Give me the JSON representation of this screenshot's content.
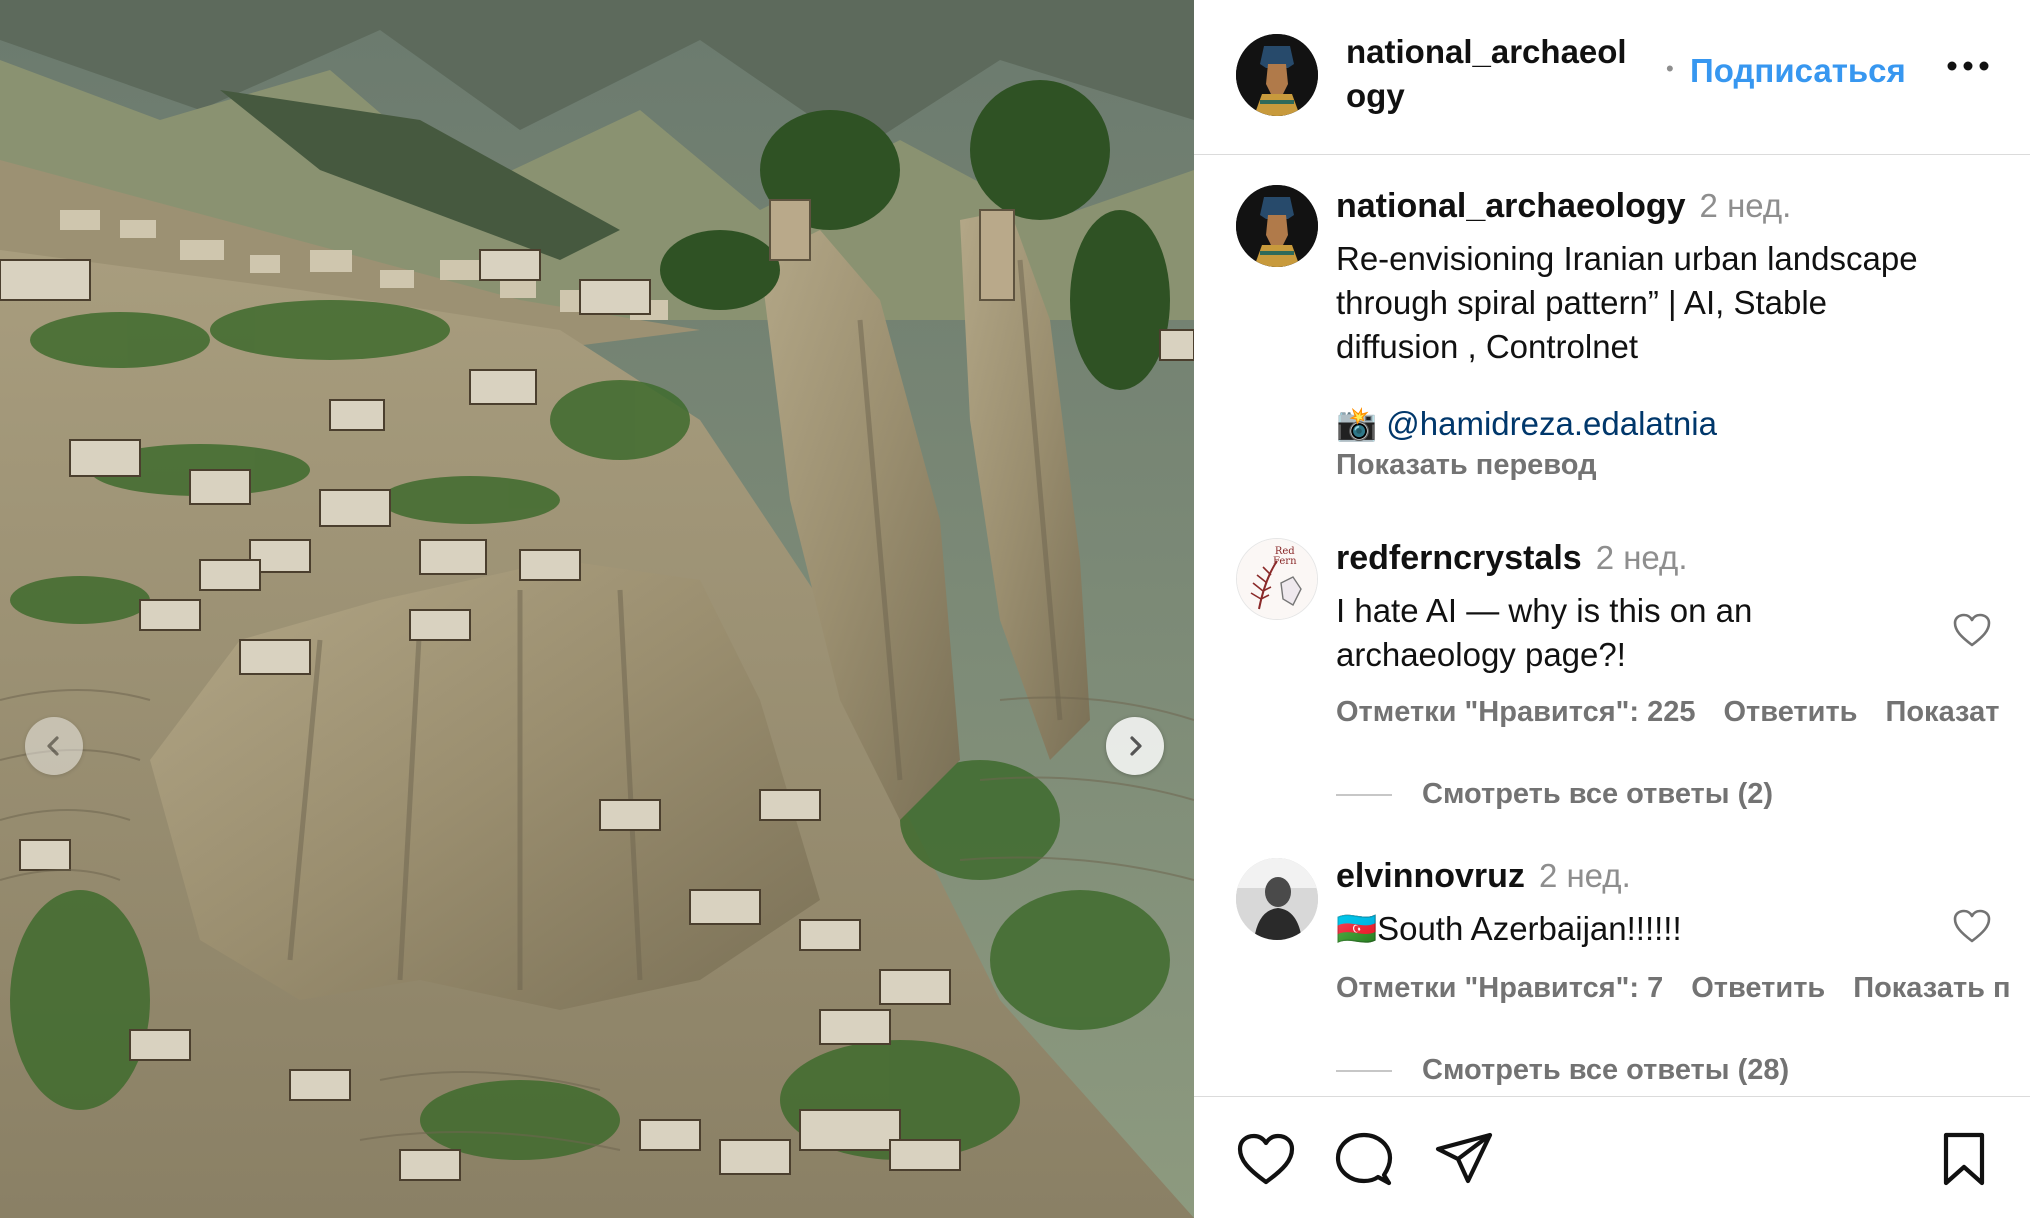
{
  "post": {
    "username": "national_archaeology",
    "header_username_line1": "national_archaeol",
    "header_username_line2": "ogy",
    "dot": "•",
    "follow_label": "Подписаться",
    "more_icon": "more-horizontal-icon"
  },
  "caption": {
    "username": "national_archaeology",
    "time": "2 нед.",
    "text_line1": "Re-envisioning Iranian urban landscape",
    "text_line2": "through spiral pattern” | AI, Stable",
    "text_line3": "diffusion , Controlnet",
    "mention_emoji": "📸",
    "mention": "@hamidreza.edalatnia",
    "translate_label": "Показать перевод"
  },
  "comments": [
    {
      "username": "redferncrystals",
      "time": "2 нед.",
      "text_line1": "I hate AI — why is this on an",
      "text_line2": "archaeology page?!",
      "likes_label": "Отметки \"Нравится\": 225",
      "reply_label": "Ответить",
      "extra_label": "Показат",
      "replies_label": "Смотреть все ответы (2)",
      "avatar_text_line1": "Red",
      "avatar_text_line2": "Fern"
    },
    {
      "username": "elvinnovruz",
      "time": "2 нед.",
      "flag": "🇦🇿",
      "text_line1": "South Azerbaijan!!!!!!",
      "likes_label": "Отметки \"Нравится\": 7",
      "reply_label": "Ответить",
      "extra_label": "Показать п",
      "replies_label": "Смотреть все ответы (28)"
    }
  ],
  "actions": [
    "heart-icon",
    "comment-icon",
    "share-icon",
    "bookmark-icon"
  ],
  "colors": {
    "link_blue": "#3797f0",
    "mention_blue": "#00376b",
    "secondary_gray": "#737373",
    "divider": "#dbdbdb"
  }
}
